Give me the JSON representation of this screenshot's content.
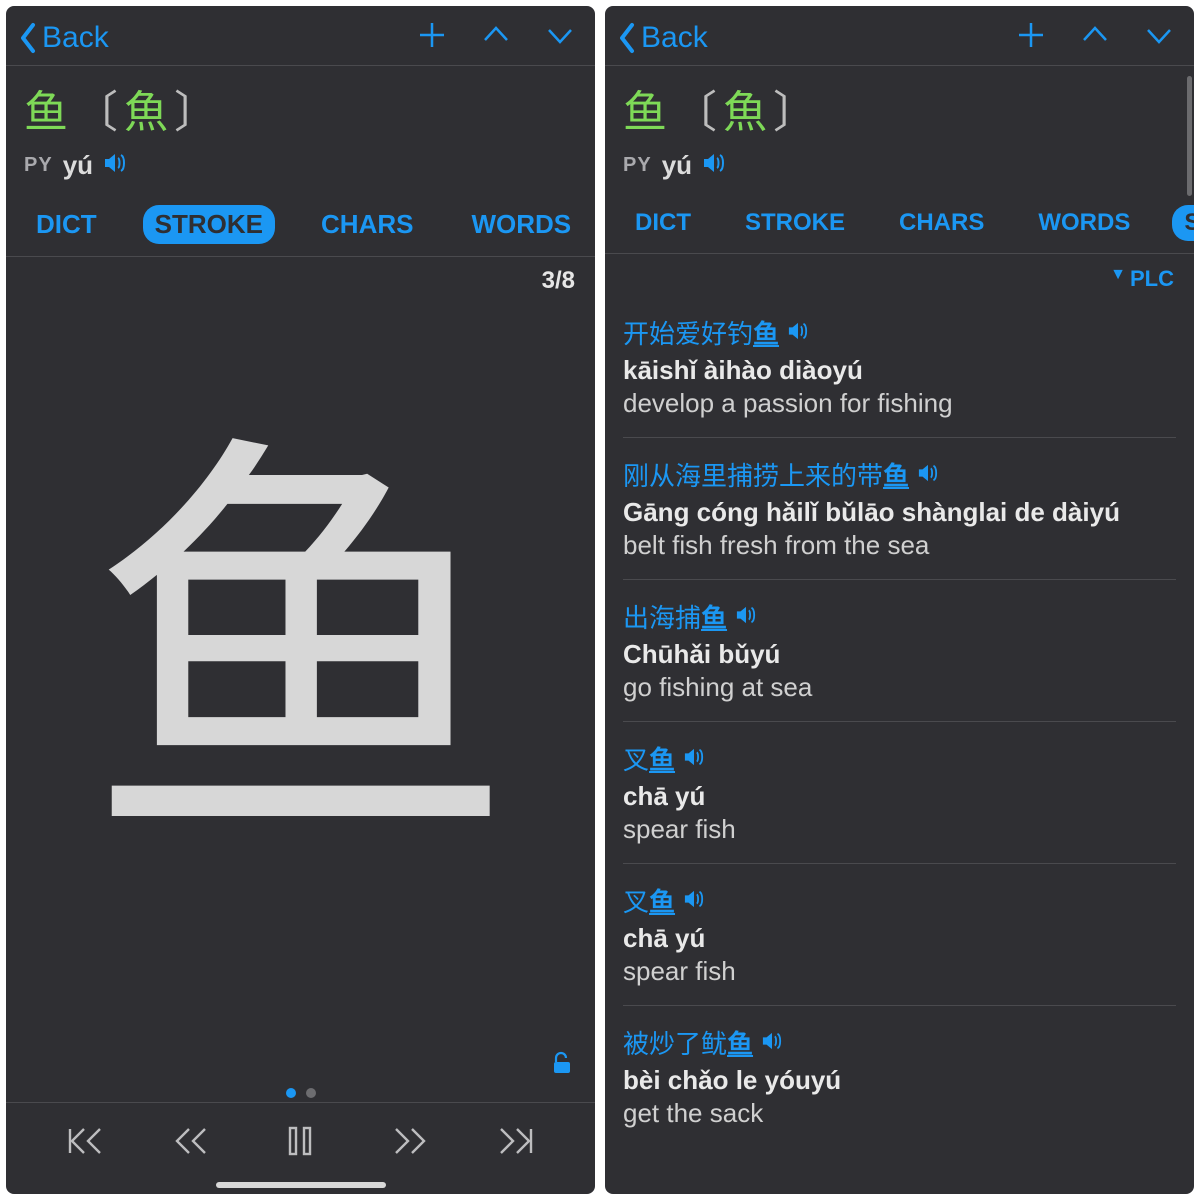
{
  "nav": {
    "back": "Back"
  },
  "entry": {
    "simplified": "鱼",
    "traditional": "魚",
    "bracket_open": "〔",
    "bracket_close": "〕",
    "pinyin_label": "PY",
    "pinyin": "yú"
  },
  "tabs": {
    "dict": "DICT",
    "stroke": "STROKE",
    "chars": "CHARS",
    "words": "WORDS",
    "sents": "SENTS"
  },
  "stroke": {
    "counter": "3/8",
    "glyph": "鱼"
  },
  "right": {
    "plc": "PLC",
    "sentences": [
      {
        "cn_pre": "开始爱好钓",
        "cn_hl": "鱼",
        "py": "kāishǐ àihào diàoyú",
        "en": "develop a passion for fishing"
      },
      {
        "cn_pre": "刚从海里捕捞上来的带",
        "cn_hl": "鱼",
        "py": "Gāng cóng hǎilǐ bǔlāo shànglai de dàiyú",
        "en": "belt fish fresh from the sea"
      },
      {
        "cn_pre": "出海捕",
        "cn_hl": "鱼",
        "py": "Chūhǎi bǔyú",
        "en": "go fishing at sea"
      },
      {
        "cn_pre": "叉",
        "cn_hl": "鱼",
        "py": "chā yú",
        "en": "spear fish"
      },
      {
        "cn_pre": "叉",
        "cn_hl": "鱼",
        "py": "chā yú",
        "en": "spear fish"
      },
      {
        "cn_pre": "被炒了鱿",
        "cn_hl": "鱼",
        "py": "bèi chǎo le yóuyú",
        "en": "get the sack"
      }
    ]
  }
}
